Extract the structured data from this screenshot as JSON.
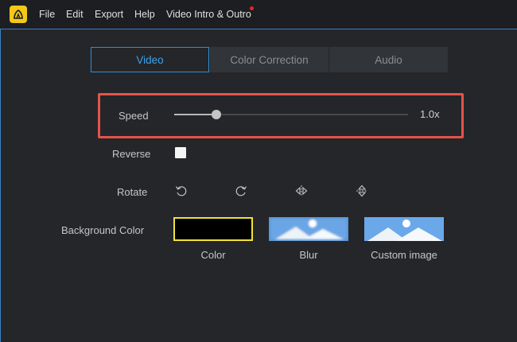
{
  "menu": {
    "items": [
      "File",
      "Edit",
      "Export",
      "Help",
      "Video Intro & Outro"
    ]
  },
  "tabs": [
    {
      "label": "Video",
      "active": true
    },
    {
      "label": "Color Correction",
      "active": false
    },
    {
      "label": "Audio",
      "active": false
    }
  ],
  "speed": {
    "label": "Speed",
    "value_label": "1.0x",
    "slider_fraction": 0.18
  },
  "reverse": {
    "label": "Reverse",
    "checked": false
  },
  "rotate": {
    "label": "Rotate",
    "icons": [
      "rotate-counterclockwise-icon",
      "rotate-clockwise-icon",
      "flip-horizontal-icon",
      "flip-vertical-icon"
    ]
  },
  "background": {
    "label": "Background Color",
    "options": [
      {
        "caption": "Color",
        "selected": true
      },
      {
        "caption": "Blur",
        "selected": false
      },
      {
        "caption": "Custom image",
        "selected": false
      }
    ]
  },
  "colors": {
    "accent": "#2f8fd8",
    "highlight": "#e5534b",
    "logo": "#f3c818",
    "selected_border": "#f2e23a"
  }
}
